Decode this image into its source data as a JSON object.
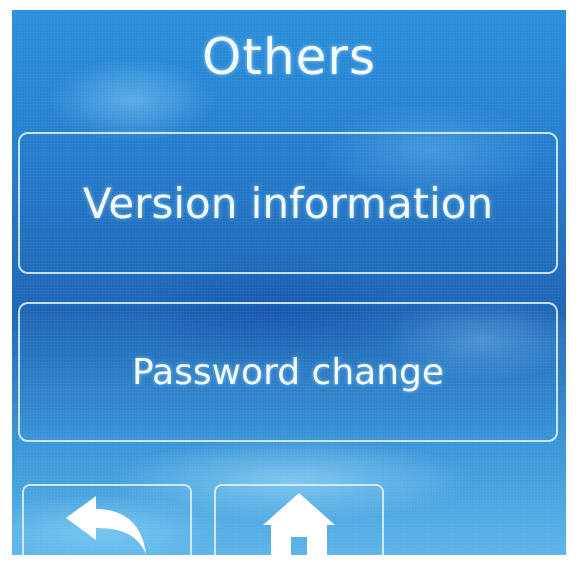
{
  "screen": {
    "title": "Others",
    "menu": {
      "version_label": "Version information",
      "password_label": "Password change"
    },
    "nav": {
      "back_icon": "back-arrow-icon",
      "home_icon": "home-icon"
    },
    "colors": {
      "background": "#2379c9",
      "text": "#f2fbff",
      "border": "#e1f5ff"
    }
  }
}
